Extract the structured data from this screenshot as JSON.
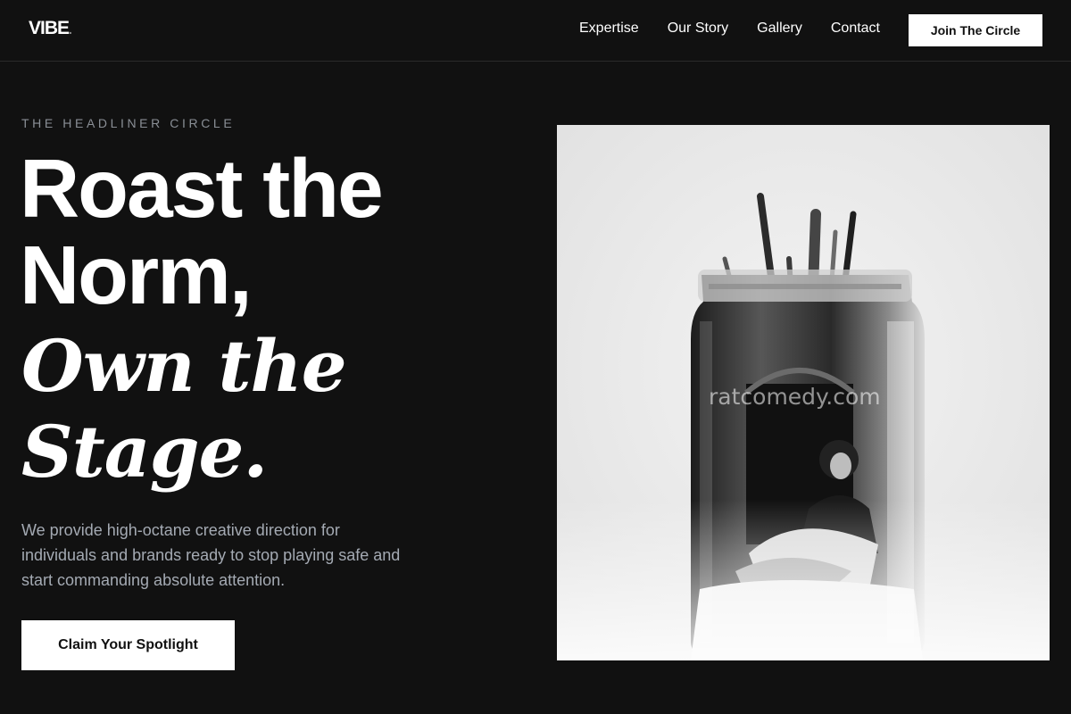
{
  "brand": {
    "logo": "VIBE",
    "logo_dot": "."
  },
  "nav": {
    "links": [
      "Expertise",
      "Our Story",
      "Gallery",
      "Contact"
    ],
    "cta_label": "Join The Circle"
  },
  "hero": {
    "eyebrow": "THE HEADLINER CIRCLE",
    "headline_line1": "Roast the",
    "headline_line2": "Norm,",
    "headline_line3": "Own the",
    "headline_line4": "Stage.",
    "lede": "We provide high-octane creative direction for individuals and brands ready to stop playing safe and start commanding absolute attention.",
    "cta_label": "Claim Your Spotlight"
  },
  "image": {
    "watermark": "ratcomedy.com"
  },
  "colors": {
    "background": "#111111",
    "text": "#ffffff",
    "muted": "#a4aab3",
    "eyebrow": "#8a8f96",
    "button_bg": "#ffffff",
    "button_text": "#111111"
  }
}
